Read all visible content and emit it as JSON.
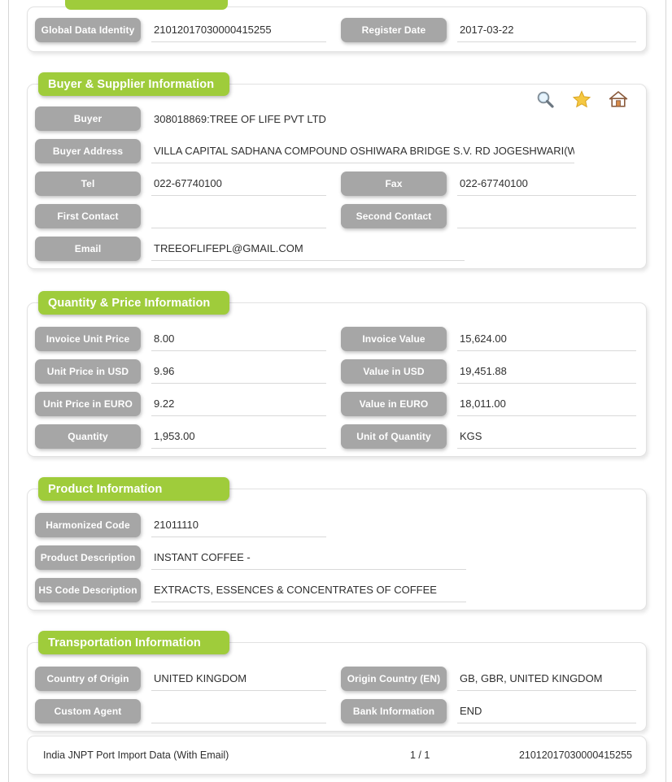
{
  "document": {
    "type": "import-trade-record"
  },
  "colors": {
    "section_green": "#9fcc3b",
    "label_gray": "#a6a6a6",
    "value_text": "#2f2f2f",
    "underline": "#d9d9d9"
  },
  "top_section": {
    "fields": [
      {
        "label": "Global Data Identity",
        "value": "21012017030000415255"
      },
      {
        "label": "Register Date",
        "value": "2017-03-22"
      }
    ]
  },
  "buyer_section": {
    "title": "Buyer & Supplier Information",
    "icons": [
      {
        "name": "search-icon",
        "title": "Search"
      },
      {
        "name": "star-icon",
        "title": "Favorite"
      },
      {
        "name": "home-icon",
        "title": "Home"
      }
    ],
    "fields": {
      "buyer": {
        "label": "Buyer",
        "value": "308018869:TREE OF LIFE PVT LTD"
      },
      "buyer_address": {
        "label": "Buyer Address",
        "value": "VILLA CAPITAL SADHANA COMPOUND OSHIWARA BRIDGE S.V. RD JOGESHWARI(W) MUI"
      },
      "tel": {
        "label": "Tel",
        "value": "022-67740100"
      },
      "fax": {
        "label": "Fax",
        "value": "022-67740100"
      },
      "first_contact": {
        "label": "First Contact",
        "value": ""
      },
      "second_contact": {
        "label": "Second Contact",
        "value": ""
      },
      "email": {
        "label": "Email",
        "value": "TREEOFLIFEPL@GMAIL.COM"
      }
    }
  },
  "quantity_section": {
    "title": "Quantity & Price Information",
    "fields": {
      "invoice_unit_price": {
        "label": "Invoice Unit Price",
        "value": "8.00"
      },
      "invoice_value": {
        "label": "Invoice Value",
        "value": "15,624.00"
      },
      "unit_price_usd": {
        "label": "Unit Price in USD",
        "value": "9.96"
      },
      "value_usd": {
        "label": "Value in USD",
        "value": "19,451.88"
      },
      "unit_price_euro": {
        "label": "Unit Price in EURO",
        "value": "9.22"
      },
      "value_euro": {
        "label": "Value in EURO",
        "value": "18,011.00"
      },
      "quantity": {
        "label": "Quantity",
        "value": "1,953.00"
      },
      "unit_of_quantity": {
        "label": "Unit of Quantity",
        "value": "KGS"
      }
    }
  },
  "product_section": {
    "title": "Product Information",
    "fields": {
      "harmonized_code": {
        "label": "Harmonized Code",
        "value": "21011110"
      },
      "product_description": {
        "label": "Product Description",
        "value": "INSTANT COFFEE -"
      },
      "hs_code_description": {
        "label": "HS Code Description",
        "value": "EXTRACTS, ESSENCES & CONCENTRATES OF COFFEE"
      }
    }
  },
  "transportation_section": {
    "title": "Transportation Information",
    "fields": {
      "country_of_origin": {
        "label": "Country of Origin",
        "value": "UNITED KINGDOM"
      },
      "origin_country_en": {
        "label": "Origin Country (EN)",
        "value": "GB, GBR, UNITED KINGDOM"
      },
      "custom_agent": {
        "label": "Custom Agent",
        "value": ""
      },
      "bank_information": {
        "label": "Bank Information",
        "value": "END"
      }
    }
  },
  "footer": {
    "source": "India JNPT Port Import Data (With Email)",
    "page": "1 / 1",
    "record_id": "21012017030000415255"
  }
}
